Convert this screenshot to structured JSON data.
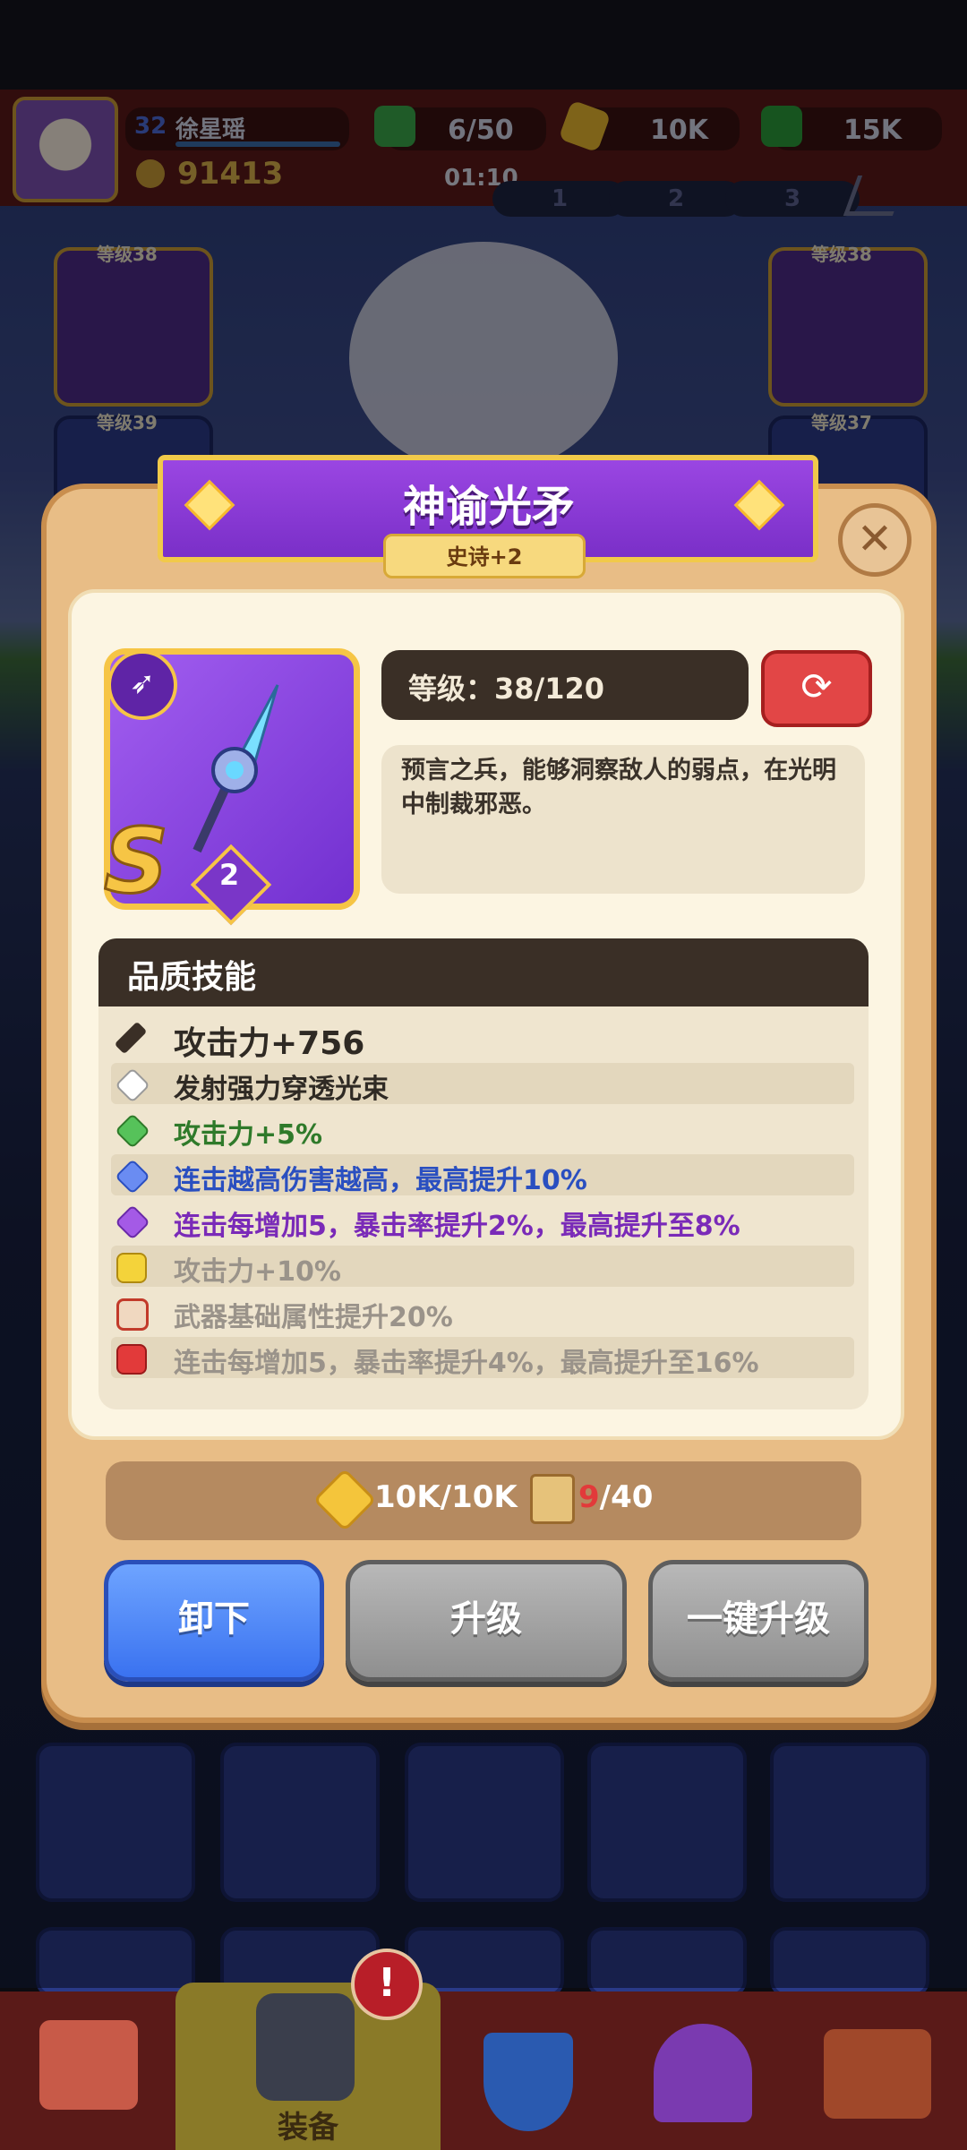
{
  "player": {
    "level": "32",
    "name": "徐星瑶",
    "power": "91413"
  },
  "resources": {
    "energy": "6/50",
    "energy_timer": "01:10",
    "gold": "10K",
    "gems": "15K"
  },
  "loadout_tabs": [
    "1",
    "2",
    "3"
  ],
  "background_slots": {
    "left_top_level": "等级38",
    "left_bottom_level": "等级39",
    "right_top_level": "等级38",
    "right_bottom_level": "等级37"
  },
  "item": {
    "name": "神谕光矛",
    "rarity": "史诗+2",
    "rank_letter": "S",
    "stars": "2",
    "level_text": "等级：38/120",
    "description": "预言之兵，能够洞察敌人的弱点，在光明中制裁邪恶。"
  },
  "skills": {
    "title": "品质技能",
    "rows": [
      {
        "text": "攻击力+756",
        "color": "#2f2a24",
        "icon": "sword-icon"
      },
      {
        "text": "发射强力穿透光束",
        "color": "#2f2a24",
        "icon": "white-gem-icon"
      },
      {
        "text": "攻击力+5%",
        "color": "#2f7a2a",
        "icon": "green-gem-icon"
      },
      {
        "text": "连击越高伤害越高，最高提升10%",
        "color": "#2a4fc0",
        "icon": "blue-gem-icon"
      },
      {
        "text": "连击每增加5，暴击率提升2%，最高提升至8%",
        "color": "#7a2ab8",
        "icon": "purple-gem-icon"
      },
      {
        "text": "攻击力+10%",
        "color": "#9a938a",
        "icon": "gold-lock-icon"
      },
      {
        "text": "武器基础属性提升20%",
        "color": "#9a938a",
        "icon": "lock-3-icon"
      },
      {
        "text": "连击每增加5，暴击率提升4%，最高提升至16%",
        "color": "#9a938a",
        "icon": "red-lock-icon"
      }
    ]
  },
  "cost": {
    "gold": "10K/10K",
    "scroll_have": "9",
    "scroll_need": "/40"
  },
  "buttons": {
    "unequip": "卸下",
    "upgrade": "升级",
    "one_click": "一键升级"
  },
  "nav": {
    "equip": "装备",
    "notification": "!"
  },
  "colors": {
    "banner": "#8a3ad8",
    "frame": "#f6c545",
    "unequip": "#3a72f0",
    "disabled": "#9a9a9a"
  }
}
